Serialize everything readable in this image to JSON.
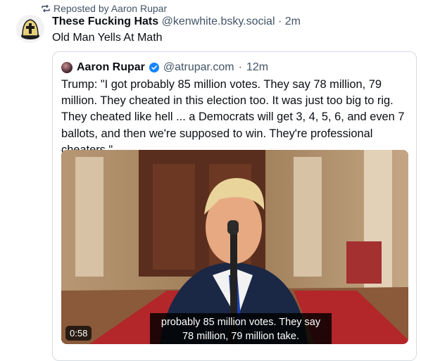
{
  "repost": {
    "icon": "repost-icon",
    "text": "Reposted by Aaron Rupar"
  },
  "post": {
    "author_name": "These Fucking Hats",
    "handle": "@kenwhite.bsky.social",
    "separator": "·",
    "time": "2m",
    "text": "Old Man Yells At Math"
  },
  "quote": {
    "author_name": "Aaron Rupar",
    "verified_icon": "verified-badge-icon",
    "handle": "@atrupar.com",
    "separator": "·",
    "time": "12m",
    "text": "Trump: \"I got probably 85 million votes. They say 78 million, 79 million. They cheated in this election too. It was just too big to rig. They cheated like hell ... a Democrats will get 3, 4, 5, 6, and even 7 ballots, and then we're supposed to win. They're professional cheaters.\"",
    "video": {
      "duration": "0:58",
      "caption_line1": "probably 85 million votes. They say",
      "caption_line2": "78 million, 79 million take."
    }
  },
  "colors": {
    "text_primary": "#0b0f14",
    "text_secondary": "#425466",
    "border": "#d4dbe2",
    "verified_blue": "#1185fe"
  }
}
